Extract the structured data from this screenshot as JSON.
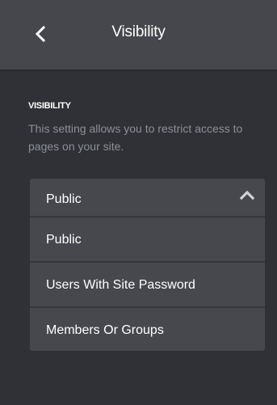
{
  "header": {
    "back_icon": "chevron-left-icon",
    "title": "Visibility"
  },
  "section": {
    "label": "VISIBILITY",
    "description": "This setting allows you to restrict access to pages on your site."
  },
  "dropdown": {
    "selected": "Public",
    "expanded": true,
    "toggle_icon": "chevron-up-icon",
    "options": [
      {
        "label": "Public"
      },
      {
        "label": "Users With Site Password"
      },
      {
        "label": "Members Or Groups"
      }
    ]
  },
  "colors": {
    "background": "#2f3136",
    "header": "#45474c",
    "panel": "#46484d",
    "muted_text": "#8c8f95"
  }
}
